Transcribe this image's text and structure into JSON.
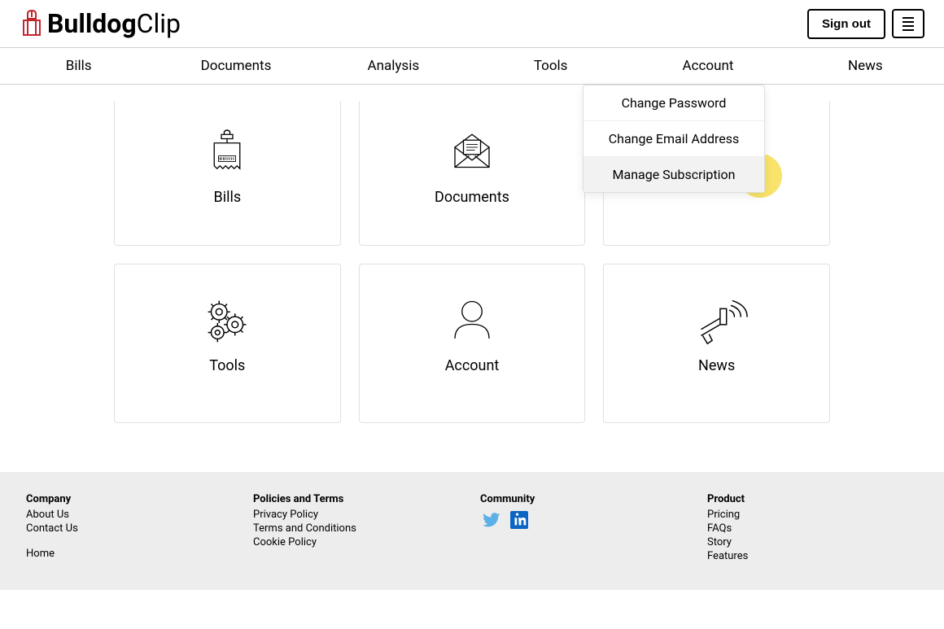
{
  "header": {
    "logo_bold": "Bulldog",
    "logo_light": "Clip",
    "sign_out": "Sign out"
  },
  "nav": {
    "items": [
      "Bills",
      "Documents",
      "Analysis",
      "Tools",
      "Account",
      "News"
    ]
  },
  "dropdown": {
    "items": [
      "Change Password",
      "Change Email Address",
      "Manage Subscription"
    ]
  },
  "cards": [
    {
      "label": "Bills",
      "icon": "receipt"
    },
    {
      "label": "Documents",
      "icon": "envelope"
    },
    {
      "label": "",
      "icon": ""
    },
    {
      "label": "Tools",
      "icon": "gears"
    },
    {
      "label": "Account",
      "icon": "person"
    },
    {
      "label": "News",
      "icon": "megaphone"
    }
  ],
  "footer": {
    "company": {
      "title": "Company",
      "links": [
        "About Us",
        "Contact Us"
      ],
      "home": "Home"
    },
    "policies": {
      "title": "Policies and Terms",
      "links": [
        "Privacy Policy",
        "Terms and Conditions",
        "Cookie Policy"
      ]
    },
    "community": {
      "title": "Community"
    },
    "product": {
      "title": "Product",
      "links": [
        "Pricing",
        "FAQs",
        "Story",
        "Features"
      ]
    }
  }
}
